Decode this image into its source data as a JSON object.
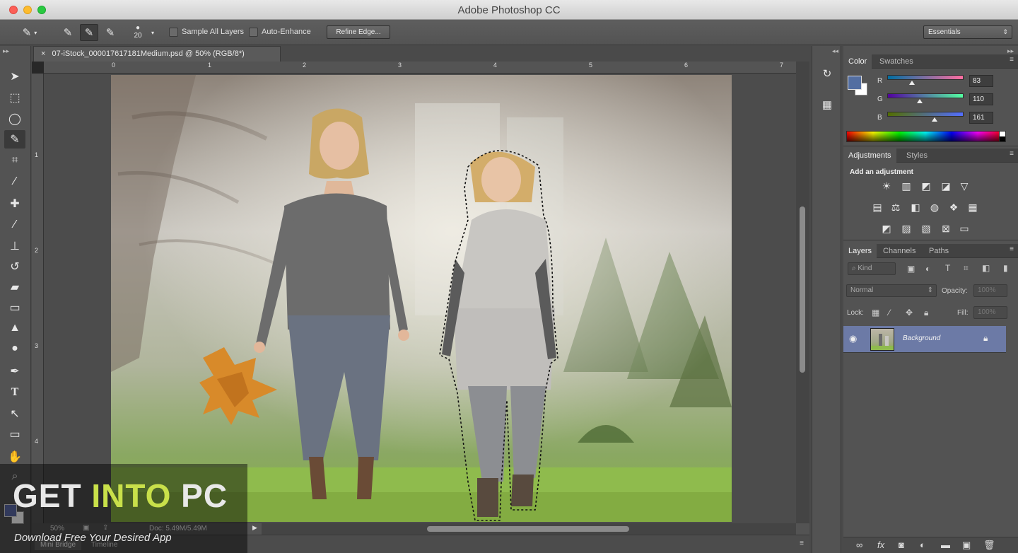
{
  "window": {
    "title": "Adobe Photoshop CC"
  },
  "options_bar": {
    "brush_size": "20",
    "sample_all_layers_label": "Sample All Layers",
    "auto_enhance_label": "Auto-Enhance",
    "refine_edge_label": "Refine Edge...",
    "workspace": "Essentials",
    "icons": [
      "quick-selection-tool-icon",
      "new-selection-icon",
      "add-to-selection-icon",
      "subtract-from-selection-icon"
    ]
  },
  "document": {
    "tab_title": "07-iStock_000017617181Medium.psd @ 50% (RGB/8*)",
    "zoom": "50%",
    "doc_size": "Doc: 5.49M/5.49M",
    "ruler_top": [
      "0",
      "1",
      "2",
      "3",
      "4",
      "5",
      "6",
      "7"
    ],
    "ruler_left": [
      "1",
      "2",
      "3",
      "4"
    ]
  },
  "tools": [
    "move-tool-icon",
    "marquee-tool-icon",
    "lasso-tool-icon",
    "quick-selection-tool-icon",
    "crop-tool-icon",
    "eyedropper-tool-icon",
    "healing-brush-icon",
    "brush-tool-icon",
    "clone-stamp-icon",
    "history-brush-icon",
    "eraser-icon",
    "gradient-icon",
    "blur-icon",
    "dodge-icon",
    "pen-tool-icon",
    "type-tool-icon",
    "path-selection-icon",
    "rectangle-tool-icon",
    "hand-tool-icon",
    "zoom-tool-icon"
  ],
  "bottom_tabs": {
    "mini_bridge": "Mini Bridge",
    "timeline": "Timeline"
  },
  "watermark": {
    "title_part1": "GET ",
    "title_part2": "INTO",
    "title_part3": " PC",
    "subtitle": "Download Free Your Desired App"
  },
  "color_panel": {
    "tabs": [
      "Color",
      "Swatches"
    ],
    "r_label": "R",
    "g_label": "G",
    "b_label": "B",
    "r": "83",
    "g": "110",
    "b": "161",
    "foreground_color": "#536ea1"
  },
  "adjustments_panel": {
    "tabs": [
      "Adjustments",
      "Styles"
    ],
    "title": "Add an adjustment",
    "icons": [
      "brightness-contrast-icon",
      "levels-icon",
      "curves-icon",
      "exposure-icon",
      "vibrance-icon",
      "hue-saturation-icon",
      "color-balance-icon",
      "black-white-icon",
      "photo-filter-icon",
      "channel-mixer-icon",
      "color-lookup-icon",
      "invert-icon",
      "posterize-icon",
      "threshold-icon",
      "selective-color-icon",
      "gradient-map-icon"
    ]
  },
  "layers_panel": {
    "tabs": [
      "Layers",
      "Channels",
      "Paths"
    ],
    "filter_kind": "Kind",
    "blend_mode": "Normal",
    "opacity_label": "Opacity:",
    "opacity_value": "100%",
    "lock_label": "Lock:",
    "fill_label": "Fill:",
    "fill_value": "100%",
    "layers": [
      {
        "name": "Background",
        "visible": true,
        "locked": true
      }
    ]
  },
  "colors": {
    "accent_selection": "#6c7aa6",
    "panel_bg": "#535353",
    "canvas_bg": "#282828"
  }
}
